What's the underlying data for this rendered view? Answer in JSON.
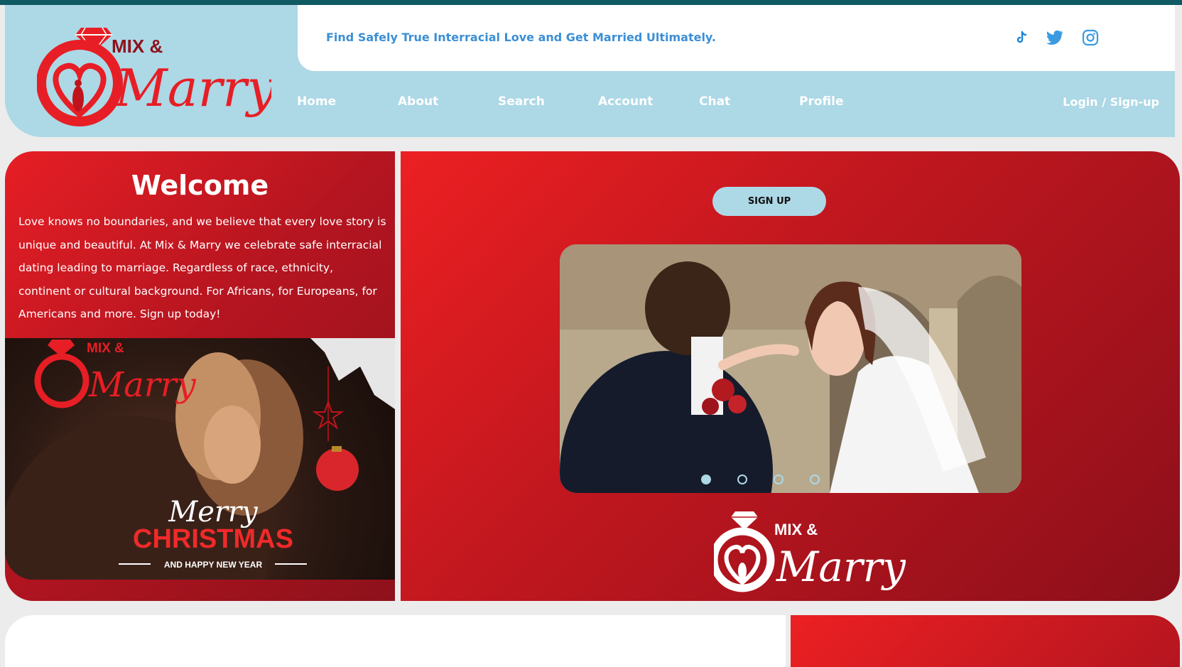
{
  "brand": {
    "logo_mark": "ring-heart-couple",
    "logo_line1": "MIX &",
    "logo_line2": "Marry",
    "primary_red": "#e71e25",
    "light_blue": "#add8e6"
  },
  "header": {
    "tagline": "Find Safely True Interracial Love and Get Married Ultimately.",
    "social": [
      "tiktok-icon",
      "twitter-icon",
      "instagram-icon"
    ],
    "nav": [
      "Home",
      "About",
      "Search",
      "Account",
      "Chat",
      "Profile"
    ],
    "login": "Login / Sign-up"
  },
  "welcome": {
    "title": "Welcome",
    "text": "Love knows no boundaries, and we believe that every love story is unique and beautiful. At Mix & Marry we celebrate safe interracial dating leading to marriage. Regardless of race, ethnicity, continent or cultural background. For Africans, for Europeans, for Americans and more. Sign up today!"
  },
  "promo": {
    "logo_line1": "MIX &",
    "logo_line2": "Marry",
    "line1": "Merry",
    "line2": "CHRISTMAS",
    "line3": "AND HAPPY NEW YEAR"
  },
  "hero": {
    "signup_label": "SIGN UP",
    "slides": 4,
    "active_slide": 1,
    "logo_line1": "MIX &",
    "logo_line2": "Marry"
  }
}
